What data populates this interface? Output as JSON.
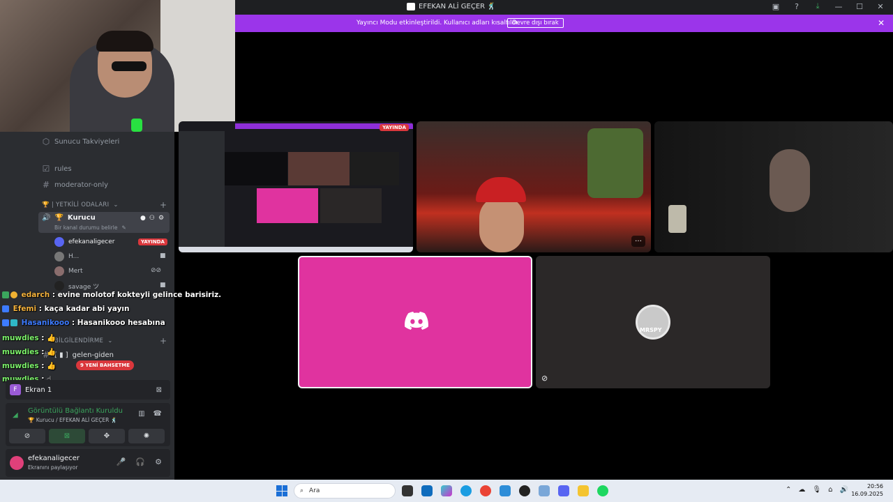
{
  "window": {
    "title": "EFEKAN ALİ GEÇER 🕺"
  },
  "banner": {
    "message": "Yayıncı Modu etkinleştirildi. Kullanıcı adları kısaltıldı.",
    "button": "Devre dışı bırak"
  },
  "sidebar": {
    "boosts": "Sunucu Takviyeleri",
    "channels": [
      "rules",
      "moderator-only"
    ],
    "category_voice": "🏆 | YETKİLİ ODALARI",
    "active_channel": {
      "name": "Kurucu",
      "status": "Bir kanal durumu belirle"
    },
    "voice_users": [
      {
        "name": "efekanaligecer",
        "badge": "YAYINDA"
      },
      {
        "name": "H..."
      },
      {
        "name": "Mert"
      },
      {
        "name": "savage ツ"
      }
    ],
    "category_info": "BİLGİLENDİRME",
    "info_channel": "gelen-giden",
    "new_mentions": "9 YENİ BAHSETME"
  },
  "chat": [
    {
      "user": "edarch",
      "text": ": evine molotof kokteyli gelince barisiriz."
    },
    {
      "user": "Efemi",
      "text": ": kaça kadar abi yayın"
    },
    {
      "user": "Hasanikooo",
      "text": ": Hasanikooo hesabına"
    },
    {
      "user": "muwdies",
      "text": ":"
    },
    {
      "user": "muwdies",
      "text": ":"
    },
    {
      "user": "muwdies",
      "text": ":"
    },
    {
      "user": "muwdies",
      "text": ":"
    }
  ],
  "screen_share": {
    "label": "Ekran 1"
  },
  "voice": {
    "status": "Görüntülü Bağlantı Kuruldu",
    "location": "🏆 Kurucu / EFEKAN ALİ GEÇER 🕺"
  },
  "user": {
    "name": "efekanaligecer",
    "status": "Ekranını paylaşıyor"
  },
  "stage": {
    "screen_badge": "YAYINDA",
    "avatar_label": "MRSPY"
  },
  "taskbar": {
    "search_placeholder": "Ara",
    "time": "20:56",
    "date": "16.09.2025"
  }
}
